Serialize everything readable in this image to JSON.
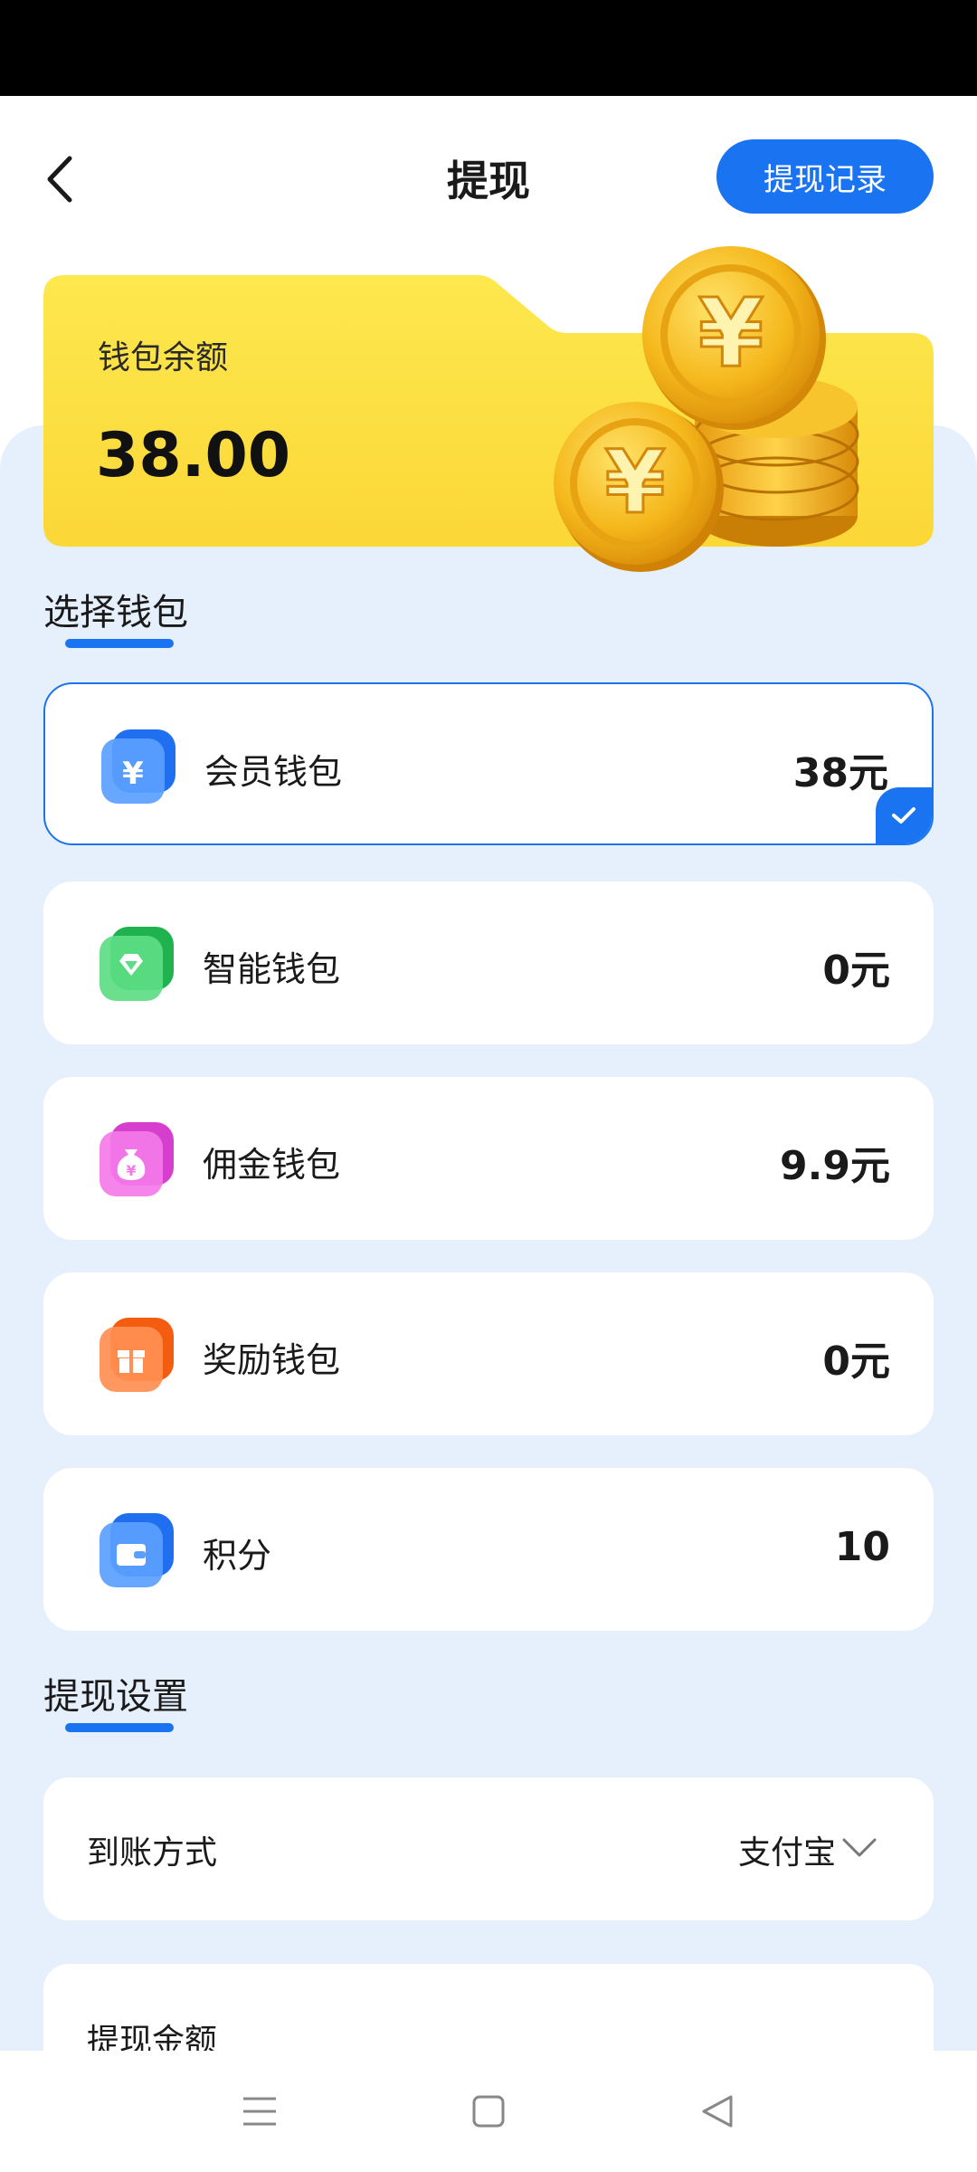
{
  "header": {
    "title": "提现",
    "record_button": "提现记录",
    "back_icon": "chevron-left-icon"
  },
  "balance": {
    "label": "钱包余额",
    "value": "38.00",
    "illustration": "gold-coins"
  },
  "wallet_section": {
    "title": "选择钱包",
    "items": [
      {
        "name": "会员钱包",
        "amount": "38元",
        "icon": "yen-icon",
        "color": "#1f6ff0",
        "selected": true
      },
      {
        "name": "智能钱包",
        "amount": "0元",
        "icon": "diamond-icon",
        "color": "#2bc25c",
        "selected": false
      },
      {
        "name": "佣金钱包",
        "amount": "9.9元",
        "icon": "money-bag-icon",
        "color": "#e04fd6",
        "selected": false
      },
      {
        "name": "奖励钱包",
        "amount": "0元",
        "icon": "gift-icon",
        "color": "#ff6a1a",
        "selected": false
      },
      {
        "name": "积分",
        "amount": "10",
        "icon": "wallet-icon",
        "color": "#1f6ff0",
        "selected": false
      }
    ]
  },
  "settings_section": {
    "title": "提现设置",
    "method": {
      "label": "到账方式",
      "value": "支付宝"
    },
    "amount": {
      "label": "提现金额"
    }
  },
  "colors": {
    "accent": "#1a73f0",
    "card_yellow": "#fde347",
    "page_bg": "#e6f0fc"
  },
  "nav": {
    "menu_icon": "menu-icon",
    "home_icon": "home-square-icon",
    "back_icon": "back-triangle-icon"
  }
}
